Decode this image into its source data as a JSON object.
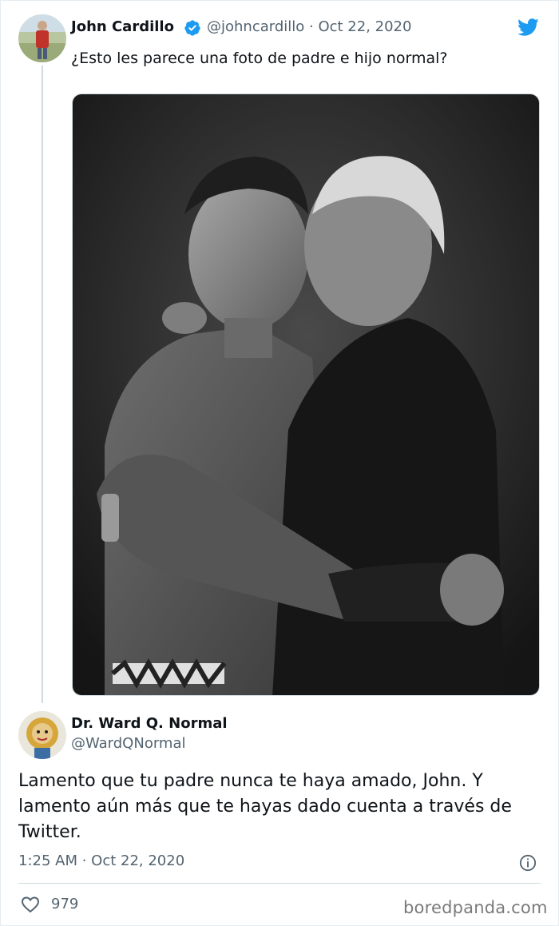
{
  "original_tweet": {
    "author_name": "John Cardillo",
    "author_handle_date": "@johncardillo · Oct 22, 2020",
    "text": "¿Esto les parece una foto de padre e hijo normal?"
  },
  "reply_tweet": {
    "author_name": "Dr. Ward Q. Normal",
    "author_handle": "@WardQNormal",
    "text": "Lamento que tu padre nunca te haya amado, John. Y lamento aún más que te hayas dado cuenta a través de Twitter.",
    "timestamp": "1:25 AM · Oct 22, 2020",
    "like_count": "979"
  },
  "watermark": "boredpanda.com",
  "colors": {
    "twitter_blue": "#1d9bf0",
    "text_primary": "#0f1419",
    "text_secondary": "#536471"
  },
  "icons": {
    "verified": "verified-badge-icon",
    "twitter": "twitter-bird-icon",
    "info": "info-icon",
    "like": "heart-icon"
  }
}
